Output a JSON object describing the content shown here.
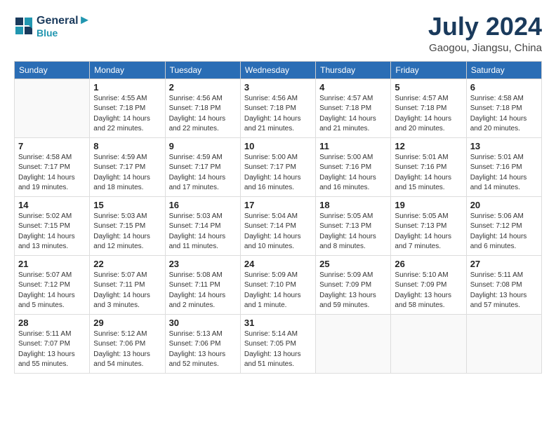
{
  "header": {
    "logo_line1": "General",
    "logo_line2": "Blue",
    "month_year": "July 2024",
    "location": "Gaogou, Jiangsu, China"
  },
  "weekdays": [
    "Sunday",
    "Monday",
    "Tuesday",
    "Wednesday",
    "Thursday",
    "Friday",
    "Saturday"
  ],
  "weeks": [
    [
      {
        "day": "",
        "info": ""
      },
      {
        "day": "1",
        "info": "Sunrise: 4:55 AM\nSunset: 7:18 PM\nDaylight: 14 hours\nand 22 minutes."
      },
      {
        "day": "2",
        "info": "Sunrise: 4:56 AM\nSunset: 7:18 PM\nDaylight: 14 hours\nand 22 minutes."
      },
      {
        "day": "3",
        "info": "Sunrise: 4:56 AM\nSunset: 7:18 PM\nDaylight: 14 hours\nand 21 minutes."
      },
      {
        "day": "4",
        "info": "Sunrise: 4:57 AM\nSunset: 7:18 PM\nDaylight: 14 hours\nand 21 minutes."
      },
      {
        "day": "5",
        "info": "Sunrise: 4:57 AM\nSunset: 7:18 PM\nDaylight: 14 hours\nand 20 minutes."
      },
      {
        "day": "6",
        "info": "Sunrise: 4:58 AM\nSunset: 7:18 PM\nDaylight: 14 hours\nand 20 minutes."
      }
    ],
    [
      {
        "day": "7",
        "info": "Sunrise: 4:58 AM\nSunset: 7:17 PM\nDaylight: 14 hours\nand 19 minutes."
      },
      {
        "day": "8",
        "info": "Sunrise: 4:59 AM\nSunset: 7:17 PM\nDaylight: 14 hours\nand 18 minutes."
      },
      {
        "day": "9",
        "info": "Sunrise: 4:59 AM\nSunset: 7:17 PM\nDaylight: 14 hours\nand 17 minutes."
      },
      {
        "day": "10",
        "info": "Sunrise: 5:00 AM\nSunset: 7:17 PM\nDaylight: 14 hours\nand 16 minutes."
      },
      {
        "day": "11",
        "info": "Sunrise: 5:00 AM\nSunset: 7:16 PM\nDaylight: 14 hours\nand 16 minutes."
      },
      {
        "day": "12",
        "info": "Sunrise: 5:01 AM\nSunset: 7:16 PM\nDaylight: 14 hours\nand 15 minutes."
      },
      {
        "day": "13",
        "info": "Sunrise: 5:01 AM\nSunset: 7:16 PM\nDaylight: 14 hours\nand 14 minutes."
      }
    ],
    [
      {
        "day": "14",
        "info": "Sunrise: 5:02 AM\nSunset: 7:15 PM\nDaylight: 14 hours\nand 13 minutes."
      },
      {
        "day": "15",
        "info": "Sunrise: 5:03 AM\nSunset: 7:15 PM\nDaylight: 14 hours\nand 12 minutes."
      },
      {
        "day": "16",
        "info": "Sunrise: 5:03 AM\nSunset: 7:14 PM\nDaylight: 14 hours\nand 11 minutes."
      },
      {
        "day": "17",
        "info": "Sunrise: 5:04 AM\nSunset: 7:14 PM\nDaylight: 14 hours\nand 10 minutes."
      },
      {
        "day": "18",
        "info": "Sunrise: 5:05 AM\nSunset: 7:13 PM\nDaylight: 14 hours\nand 8 minutes."
      },
      {
        "day": "19",
        "info": "Sunrise: 5:05 AM\nSunset: 7:13 PM\nDaylight: 14 hours\nand 7 minutes."
      },
      {
        "day": "20",
        "info": "Sunrise: 5:06 AM\nSunset: 7:12 PM\nDaylight: 14 hours\nand 6 minutes."
      }
    ],
    [
      {
        "day": "21",
        "info": "Sunrise: 5:07 AM\nSunset: 7:12 PM\nDaylight: 14 hours\nand 5 minutes."
      },
      {
        "day": "22",
        "info": "Sunrise: 5:07 AM\nSunset: 7:11 PM\nDaylight: 14 hours\nand 3 minutes."
      },
      {
        "day": "23",
        "info": "Sunrise: 5:08 AM\nSunset: 7:11 PM\nDaylight: 14 hours\nand 2 minutes."
      },
      {
        "day": "24",
        "info": "Sunrise: 5:09 AM\nSunset: 7:10 PM\nDaylight: 14 hours\nand 1 minute."
      },
      {
        "day": "25",
        "info": "Sunrise: 5:09 AM\nSunset: 7:09 PM\nDaylight: 13 hours\nand 59 minutes."
      },
      {
        "day": "26",
        "info": "Sunrise: 5:10 AM\nSunset: 7:09 PM\nDaylight: 13 hours\nand 58 minutes."
      },
      {
        "day": "27",
        "info": "Sunrise: 5:11 AM\nSunset: 7:08 PM\nDaylight: 13 hours\nand 57 minutes."
      }
    ],
    [
      {
        "day": "28",
        "info": "Sunrise: 5:11 AM\nSunset: 7:07 PM\nDaylight: 13 hours\nand 55 minutes."
      },
      {
        "day": "29",
        "info": "Sunrise: 5:12 AM\nSunset: 7:06 PM\nDaylight: 13 hours\nand 54 minutes."
      },
      {
        "day": "30",
        "info": "Sunrise: 5:13 AM\nSunset: 7:06 PM\nDaylight: 13 hours\nand 52 minutes."
      },
      {
        "day": "31",
        "info": "Sunrise: 5:14 AM\nSunset: 7:05 PM\nDaylight: 13 hours\nand 51 minutes."
      },
      {
        "day": "",
        "info": ""
      },
      {
        "day": "",
        "info": ""
      },
      {
        "day": "",
        "info": ""
      }
    ]
  ]
}
